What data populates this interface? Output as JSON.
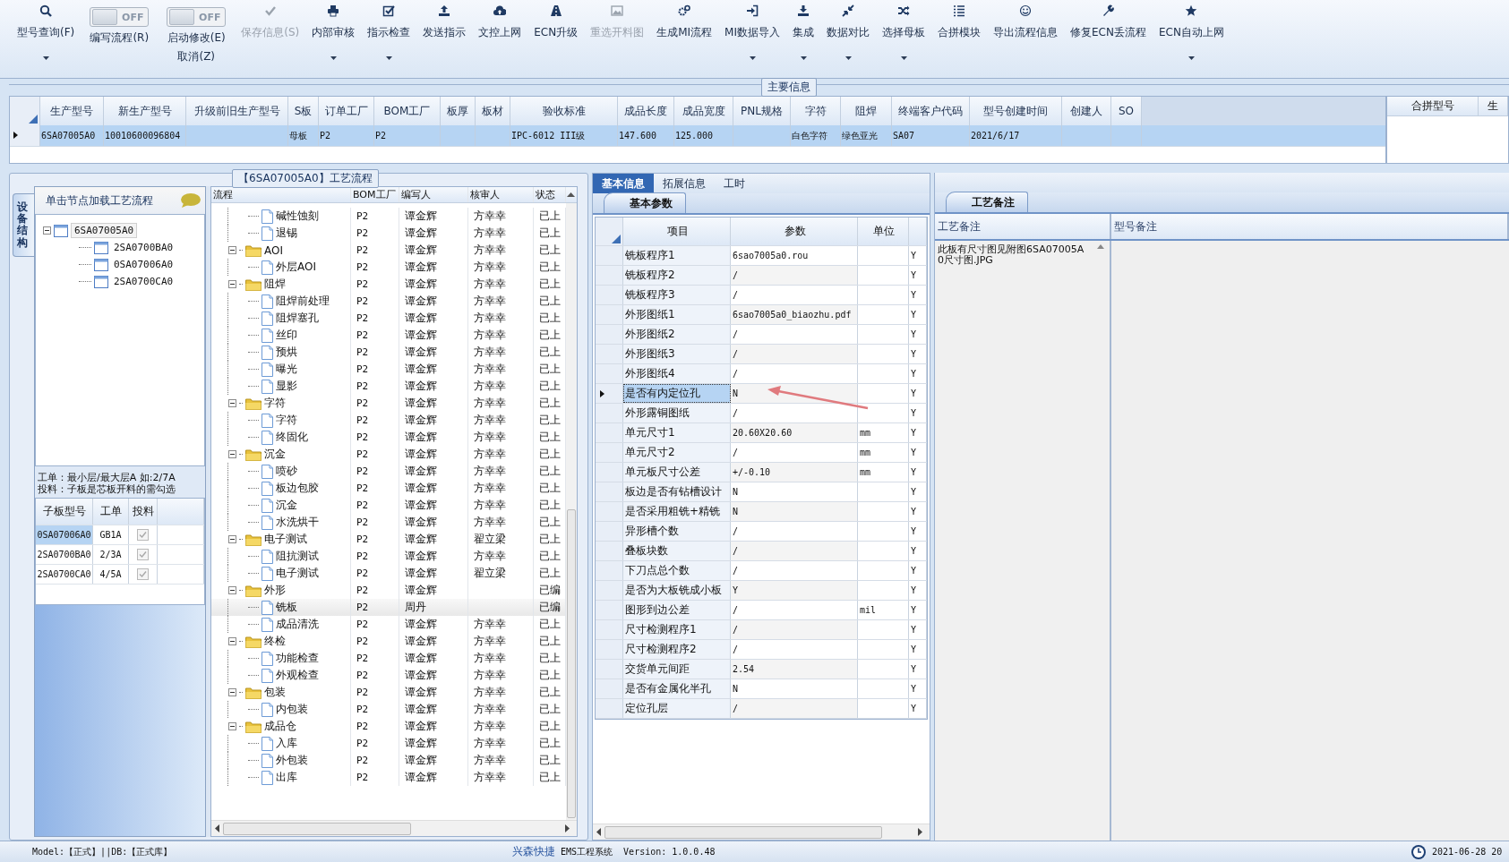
{
  "toolbar": [
    {
      "kind": "button",
      "label": "型号查询(F)",
      "dropdown": true,
      "disabled": false
    },
    {
      "kind": "toggle",
      "state_text": "OFF",
      "on": false,
      "label": "编写流程(R)"
    },
    {
      "kind": "toggle",
      "state_text": "OFF",
      "on": false,
      "label": "启动修改(E)",
      "sublabel": "取消(Z)"
    },
    {
      "kind": "button",
      "label": "保存信息(S)",
      "dropdown": false,
      "disabled": true
    },
    {
      "kind": "button",
      "label": "内部审核",
      "dropdown": true,
      "disabled": false
    },
    {
      "kind": "button",
      "label": "指示检查",
      "dropdown": true,
      "disabled": false
    },
    {
      "kind": "button",
      "label": "发送指示",
      "dropdown": false,
      "disabled": false
    },
    {
      "kind": "button",
      "label": "文控上网",
      "dropdown": false,
      "disabled": false
    },
    {
      "kind": "button",
      "label": "ECN升级",
      "dropdown": false,
      "disabled": false
    },
    {
      "kind": "button",
      "label": "重选开料图",
      "dropdown": false,
      "disabled": true
    },
    {
      "kind": "button",
      "label": "生成MI流程",
      "dropdown": false,
      "disabled": false
    },
    {
      "kind": "button",
      "label": "MI数据导入",
      "dropdown": true,
      "disabled": false
    },
    {
      "kind": "button",
      "label": "集成",
      "dropdown": true,
      "disabled": false
    },
    {
      "kind": "button",
      "label": "数据对比",
      "dropdown": true,
      "disabled": false
    },
    {
      "kind": "button",
      "label": "选择母板",
      "dropdown": true,
      "disabled": false
    },
    {
      "kind": "button",
      "label": "合拼模块",
      "dropdown": false,
      "disabled": false
    },
    {
      "kind": "button",
      "label": "导出流程信息",
      "dropdown": false,
      "disabled": false
    },
    {
      "kind": "button",
      "label": "修复ECN丢流程",
      "dropdown": false,
      "disabled": false
    },
    {
      "kind": "button",
      "label": "ECN自动上网",
      "dropdown": true,
      "disabled": false
    }
  ],
  "main_info": {
    "title": "主要信息",
    "columns": [
      "生产型号",
      "新生产型号",
      "升级前旧生产型号",
      "S板",
      "订单工厂",
      "BOM工厂",
      "板厚",
      "板材",
      "验收标准",
      "成品长度",
      "成品宽度",
      "PNL规格",
      "字符",
      "阻焊",
      "终端客户代码",
      "型号创建时间",
      "创建人",
      "SO"
    ],
    "rows": [
      {
        "selected": true,
        "cells": [
          "6SA07005A0",
          "10010600096804",
          null,
          "母板",
          "P2",
          "P2",
          null,
          null,
          "IPC-6012 III级",
          "147.600",
          "125.000",
          null,
          "白色字符",
          "绿色亚光",
          "SA07",
          "2021/6/17",
          null,
          null
        ]
      }
    ],
    "side_columns": [
      "合拼型号",
      "生"
    ]
  },
  "process_panel": {
    "title": "【6SA07005A0】工艺流程",
    "side_tab": "设备结构",
    "hint": "单击节点加载工艺流程",
    "tree": [
      {
        "label": "6SA07005A0",
        "expanded": true,
        "selected": true,
        "children": [
          {
            "label": "2SA0700BA0",
            "selected": false
          },
          {
            "label": "0SA07006A0",
            "selected": false
          },
          {
            "label": "2SA0700CA0",
            "selected": false
          }
        ]
      }
    ],
    "notes": [
      "工单：最小层/最大层A 如:2/7A",
      "投料：子板是芯板开料的需勾选"
    ],
    "sub_boards": {
      "columns": [
        "子板型号",
        "工单",
        "投料"
      ],
      "rows": [
        {
          "board": "0SA07006A0",
          "order": "GB1A",
          "checked": true,
          "selected": true
        },
        {
          "board": "2SA0700BA0",
          "order": "2/3A",
          "checked": true,
          "selected": false
        },
        {
          "board": "2SA0700CA0",
          "order": "4/5A",
          "checked": true,
          "selected": false
        }
      ]
    },
    "flow": {
      "columns": [
        "流程",
        "BOM工厂",
        "编写人",
        "核审人",
        "状态"
      ],
      "rows": [
        {
          "kind": "group",
          "children": [
            {
              "kind": "step",
              "label": "碱性蚀刻",
              "bom": "P2",
              "writer": "谭金辉",
              "reviewer": "方幸幸",
              "status": "已上",
              "selected": false
            },
            {
              "kind": "step",
              "label": "退锡",
              "bom": "P2",
              "writer": "谭金辉",
              "reviewer": "方幸幸",
              "status": "已上",
              "selected": false
            }
          ]
        },
        {
          "kind": "group",
          "label": "AOI",
          "bom": "P2",
          "writer": "谭金辉",
          "reviewer": "方幸幸",
          "status": "已上",
          "expanded": true,
          "selected": false,
          "children": [
            {
              "kind": "step",
              "label": "外层AOI",
              "bom": "P2",
              "writer": "谭金辉",
              "reviewer": "方幸幸",
              "status": "已上",
              "selected": false
            }
          ]
        },
        {
          "kind": "group",
          "label": "阻焊",
          "bom": "P2",
          "writer": "谭金辉",
          "reviewer": "方幸幸",
          "status": "已上",
          "expanded": true,
          "selected": false,
          "children": [
            {
              "kind": "step",
              "label": "阻焊前处理",
              "bom": "P2",
              "writer": "谭金辉",
              "reviewer": "方幸幸",
              "status": "已上",
              "selected": false
            },
            {
              "kind": "step",
              "label": "阻焊塞孔",
              "bom": "P2",
              "writer": "谭金辉",
              "reviewer": "方幸幸",
              "status": "已上",
              "selected": false
            },
            {
              "kind": "step",
              "label": "丝印",
              "bom": "P2",
              "writer": "谭金辉",
              "reviewer": "方幸幸",
              "status": "已上",
              "selected": false
            },
            {
              "kind": "step",
              "label": "预烘",
              "bom": "P2",
              "writer": "谭金辉",
              "reviewer": "方幸幸",
              "status": "已上",
              "selected": false
            },
            {
              "kind": "step",
              "label": "曝光",
              "bom": "P2",
              "writer": "谭金辉",
              "reviewer": "方幸幸",
              "status": "已上",
              "selected": false
            },
            {
              "kind": "step",
              "label": "显影",
              "bom": "P2",
              "writer": "谭金辉",
              "reviewer": "方幸幸",
              "status": "已上",
              "selected": false
            }
          ]
        },
        {
          "kind": "group",
          "label": "字符",
          "bom": "P2",
          "writer": "谭金辉",
          "reviewer": "方幸幸",
          "status": "已上",
          "expanded": true,
          "selected": false,
          "children": [
            {
              "kind": "step",
              "label": "字符",
              "bom": "P2",
              "writer": "谭金辉",
              "reviewer": "方幸幸",
              "status": "已上",
              "selected": false
            },
            {
              "kind": "step",
              "label": "终固化",
              "bom": "P2",
              "writer": "谭金辉",
              "reviewer": "方幸幸",
              "status": "已上",
              "selected": false
            }
          ]
        },
        {
          "kind": "group",
          "label": "沉金",
          "bom": "P2",
          "writer": "谭金辉",
          "reviewer": "方幸幸",
          "status": "已上",
          "expanded": true,
          "selected": false,
          "children": [
            {
              "kind": "step",
              "label": "喷砂",
              "bom": "P2",
              "writer": "谭金辉",
              "reviewer": "方幸幸",
              "status": "已上",
              "selected": false
            },
            {
              "kind": "step",
              "label": "板边包胶",
              "bom": "P2",
              "writer": "谭金辉",
              "reviewer": "方幸幸",
              "status": "已上",
              "selected": false
            },
            {
              "kind": "step",
              "label": "沉金",
              "bom": "P2",
              "writer": "谭金辉",
              "reviewer": "方幸幸",
              "status": "已上",
              "selected": false
            },
            {
              "kind": "step",
              "label": "水洗烘干",
              "bom": "P2",
              "writer": "谭金辉",
              "reviewer": "方幸幸",
              "status": "已上",
              "selected": false
            }
          ]
        },
        {
          "kind": "group",
          "label": "电子测试",
          "bom": "P2",
          "writer": "谭金辉",
          "reviewer": "翟立梁",
          "status": "已上",
          "expanded": true,
          "selected": false,
          "children": [
            {
              "kind": "step",
              "label": "阻抗测试",
              "bom": "P2",
              "writer": "谭金辉",
              "reviewer": "方幸幸",
              "status": "已上",
              "selected": false
            },
            {
              "kind": "step",
              "label": "电子测试",
              "bom": "P2",
              "writer": "谭金辉",
              "reviewer": "翟立梁",
              "status": "已上",
              "selected": false
            }
          ]
        },
        {
          "kind": "group",
          "label": "外形",
          "bom": "P2",
          "writer": "谭金辉",
          "status": "已编",
          "expanded": true,
          "selected": false,
          "children": [
            {
              "kind": "step",
              "label": "铣板",
              "bom": "P2",
              "writer": "周丹",
              "status": "已编",
              "selected": true
            },
            {
              "kind": "step",
              "label": "成品清洗",
              "bom": "P2",
              "writer": "谭金辉",
              "reviewer": "方幸幸",
              "status": "已上",
              "selected": false
            }
          ]
        },
        {
          "kind": "group",
          "label": "终检",
          "bom": "P2",
          "writer": "谭金辉",
          "reviewer": "方幸幸",
          "status": "已上",
          "expanded": true,
          "selected": false,
          "children": [
            {
              "kind": "step",
              "label": "功能检查",
              "bom": "P2",
              "writer": "谭金辉",
              "reviewer": "方幸幸",
              "status": "已上",
              "selected": false
            },
            {
              "kind": "step",
              "label": "外观检查",
              "bom": "P2",
              "writer": "谭金辉",
              "reviewer": "方幸幸",
              "status": "已上",
              "selected": false
            }
          ]
        },
        {
          "kind": "group",
          "label": "包装",
          "bom": "P2",
          "writer": "谭金辉",
          "reviewer": "方幸幸",
          "status": "已上",
          "expanded": true,
          "selected": false,
          "children": [
            {
              "kind": "step",
              "label": "内包装",
              "bom": "P2",
              "writer": "谭金辉",
              "reviewer": "方幸幸",
              "status": "已上",
              "selected": false
            }
          ]
        },
        {
          "kind": "group",
          "label": "成品仓",
          "bom": "P2",
          "writer": "谭金辉",
          "reviewer": "方幸幸",
          "status": "已上",
          "expanded": true,
          "selected": false,
          "children": [
            {
              "kind": "step",
              "label": "入库",
              "bom": "P2",
              "writer": "谭金辉",
              "reviewer": "方幸幸",
              "status": "已上",
              "selected": false
            },
            {
              "kind": "step",
              "label": "外包装",
              "bom": "P2",
              "writer": "谭金辉",
              "reviewer": "方幸幸",
              "status": "已上",
              "selected": false
            },
            {
              "kind": "step",
              "label": "出库",
              "bom": "P2",
              "writer": "谭金辉",
              "reviewer": "方幸幸",
              "status": "已上",
              "selected": false
            }
          ]
        }
      ]
    }
  },
  "detail_panel": {
    "tabs": [
      {
        "label": "基本信息",
        "selected": true
      },
      {
        "label": "拓展信息",
        "selected": false
      },
      {
        "label": "工时",
        "selected": false
      }
    ],
    "subtab": "基本参数",
    "columns": [
      "项目",
      "参数",
      "单位"
    ],
    "rows": [
      {
        "item": "铣板程序1",
        "value": "6sao7005a0.rou",
        "flag": "Y",
        "selected": false
      },
      {
        "item": "铣板程序2",
        "value": "/",
        "flag": "Y",
        "selected": false
      },
      {
        "item": "铣板程序3",
        "value": "/",
        "flag": "Y",
        "selected": false
      },
      {
        "item": "外形图纸1",
        "value": "6sao7005a0_biaozhu.pdf",
        "flag": "Y",
        "selected": false
      },
      {
        "item": "外形图纸2",
        "value": "/",
        "flag": "Y",
        "selected": false
      },
      {
        "item": "外形图纸3",
        "value": "/",
        "flag": "Y",
        "selected": false
      },
      {
        "item": "外形图纸4",
        "value": "/",
        "flag": "Y",
        "selected": false
      },
      {
        "item": "是否有内定位孔",
        "value": "N",
        "flag": "Y",
        "selected": true
      },
      {
        "item": "外形露铜图纸",
        "value": "/",
        "flag": "Y",
        "selected": false
      },
      {
        "item": "单元尺寸1",
        "value": "20.60X20.60",
        "unit": "mm",
        "flag": "Y",
        "selected": false
      },
      {
        "item": "单元尺寸2",
        "value": "/",
        "unit": "mm",
        "flag": "Y",
        "selected": false
      },
      {
        "item": "单元板尺寸公差",
        "value": "+/-0.10",
        "unit": "mm",
        "flag": "Y",
        "selected": false
      },
      {
        "item": "板边是否有钻槽设计",
        "value": "N",
        "flag": "Y",
        "selected": false
      },
      {
        "item": "是否采用粗铣+精铣",
        "value": "N",
        "flag": "Y",
        "selected": false
      },
      {
        "item": "异形槽个数",
        "value": "/",
        "flag": "Y",
        "selected": false
      },
      {
        "item": "叠板块数",
        "value": "/",
        "flag": "Y",
        "selected": false
      },
      {
        "item": "下刀点总个数",
        "value": "/",
        "flag": "Y",
        "selected": false
      },
      {
        "item": "是否为大板铣成小板",
        "value": "Y",
        "flag": "Y",
        "selected": false
      },
      {
        "item": "图形到边公差",
        "value": "/",
        "unit": "mil",
        "flag": "Y",
        "selected": false
      },
      {
        "item": "尺寸检测程序1",
        "value": "/",
        "flag": "Y",
        "selected": false
      },
      {
        "item": "尺寸检测程序2",
        "value": "/",
        "flag": "Y",
        "selected": false
      },
      {
        "item": "交货单元间距",
        "value": "2.54",
        "flag": "Y",
        "selected": false
      },
      {
        "item": "是否有金属化半孔",
        "value": "N",
        "flag": "Y",
        "selected": false
      },
      {
        "item": "定位孔层",
        "value": "/",
        "flag": "Y",
        "selected": false
      }
    ]
  },
  "remarks_panel": {
    "subtab": "工艺备注",
    "columns": [
      "工艺备注",
      "型号备注"
    ],
    "process_remark": "此板有尺寸图见附图6SA07005A0尺寸图.JPG"
  },
  "status_bar": {
    "mode": "Model:【正式】||DB:【正式库】",
    "company": "兴森快捷",
    "system": "EMS工程系统  Version: 1.0.0.48",
    "datetime": "2021-06-28 20"
  }
}
